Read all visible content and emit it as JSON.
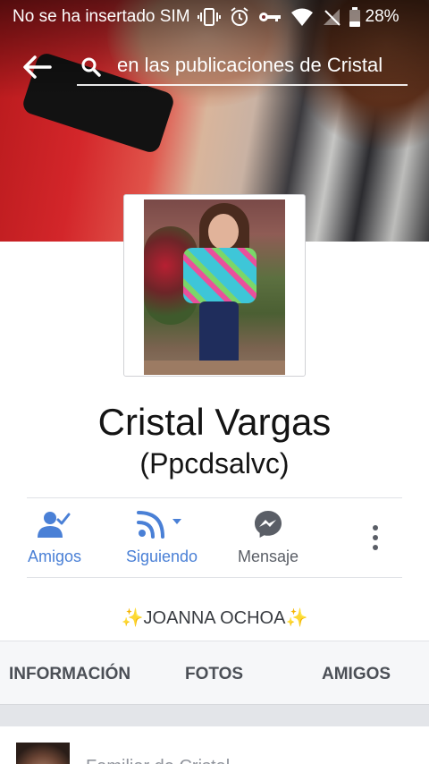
{
  "status_bar": {
    "carrier": "No se ha insertado SIM",
    "icons": [
      "vibrate-icon",
      "alarm-icon",
      "key-icon",
      "wifi-icon",
      "no-signal-icon",
      "battery-icon"
    ],
    "battery": "28%"
  },
  "header": {
    "search_text": "en las publicaciones de Cristal"
  },
  "profile": {
    "name": "Cristal Vargas",
    "alternate_name": "(Ppcdsalvc)",
    "featured": "✨JOANNA OCHOA✨"
  },
  "actions": [
    {
      "label": "Amigos",
      "icon": "friends-check-icon",
      "color": "#4a80d6"
    },
    {
      "label": "Siguiendo",
      "icon": "rss-follow-icon",
      "color": "#4a80d6"
    },
    {
      "label": "Mensaje",
      "icon": "messenger-icon",
      "color": "#5a5e66"
    }
  ],
  "tabs": [
    "INFORMACIÓN",
    "FOTOS",
    "AMIGOS"
  ],
  "post_preview": {
    "text": "Familiar de Cristal"
  },
  "colors": {
    "accent": "#4a80d6",
    "tab_bg": "#f6f7f9",
    "divider": "#e0e2e6"
  }
}
